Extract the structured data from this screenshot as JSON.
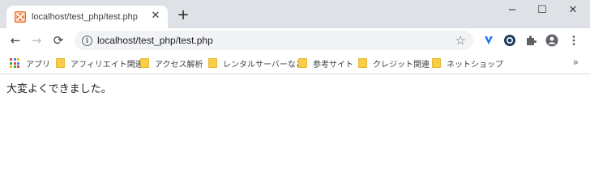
{
  "tab": {
    "title": "localhost/test_php/test.php",
    "close_glyph": "✕"
  },
  "window": {
    "minimize": "−",
    "maximize": "☐",
    "close": "✕",
    "new_tab": "+"
  },
  "toolbar": {
    "back": "←",
    "forward": "→",
    "reload": "⟳",
    "url": "localhost/test_php/test.php",
    "info": "i",
    "star": "☆"
  },
  "extensions": [
    "v-extension-icon",
    "shield-extension-icon",
    "puzzle-icon",
    "profile-icon",
    "menu-kebab-icon"
  ],
  "bookmarks": {
    "apps_label": "アプリ",
    "items": [
      {
        "label": "アフィリエイト関連"
      },
      {
        "label": "アクセス解析"
      },
      {
        "label": "レンタルサーバーなど"
      },
      {
        "label": "参考サイト"
      },
      {
        "label": "クレジット関連"
      },
      {
        "label": "ネットショップ"
      }
    ],
    "more": "»"
  },
  "page": {
    "message": "大変よくできました。"
  },
  "colors": {
    "titlebar": "#dee1e6",
    "omnibox": "#f1f3f4",
    "favicon": "#f26b21",
    "folder": "#f8cd49"
  }
}
